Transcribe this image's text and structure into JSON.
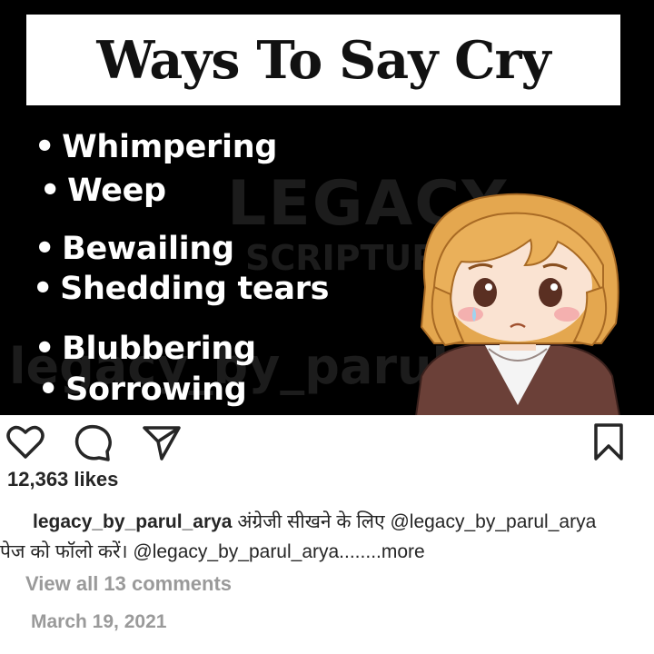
{
  "post": {
    "title": "Ways To Say Cry",
    "watermark": {
      "line1": "LEGACY",
      "line2": "SCRIPTURE",
      "line3": "legacy_by_parul_arya"
    },
    "bullets": [
      "Whimpering",
      "Weep",
      "Bewailing",
      "Shedding tears",
      "Blubbering",
      "Sorrowing"
    ],
    "bullet_symbol": "•",
    "illustration": "crying-girl-illustration"
  },
  "actions": {
    "like_icon": "heart-icon",
    "comment_icon": "comment-icon",
    "share_icon": "send-icon",
    "save_icon": "bookmark-icon"
  },
  "likes": "12,363 likes",
  "caption": {
    "username": "legacy_by_parul_arya",
    "line1_text": "अंग्रेजी सीखने के लिए @legacy_by_parul_arya",
    "line2_text": "पेज को फॉलो करें। @legacy_by_parul_arya........",
    "more_label": "more"
  },
  "view_comments": "View all 13 comments",
  "date": "March 19, 2021",
  "colors": {
    "post_background": "#000000",
    "text_primary": "#262626",
    "text_secondary": "#9a9a9a",
    "watermark": "#1c1c1c"
  }
}
